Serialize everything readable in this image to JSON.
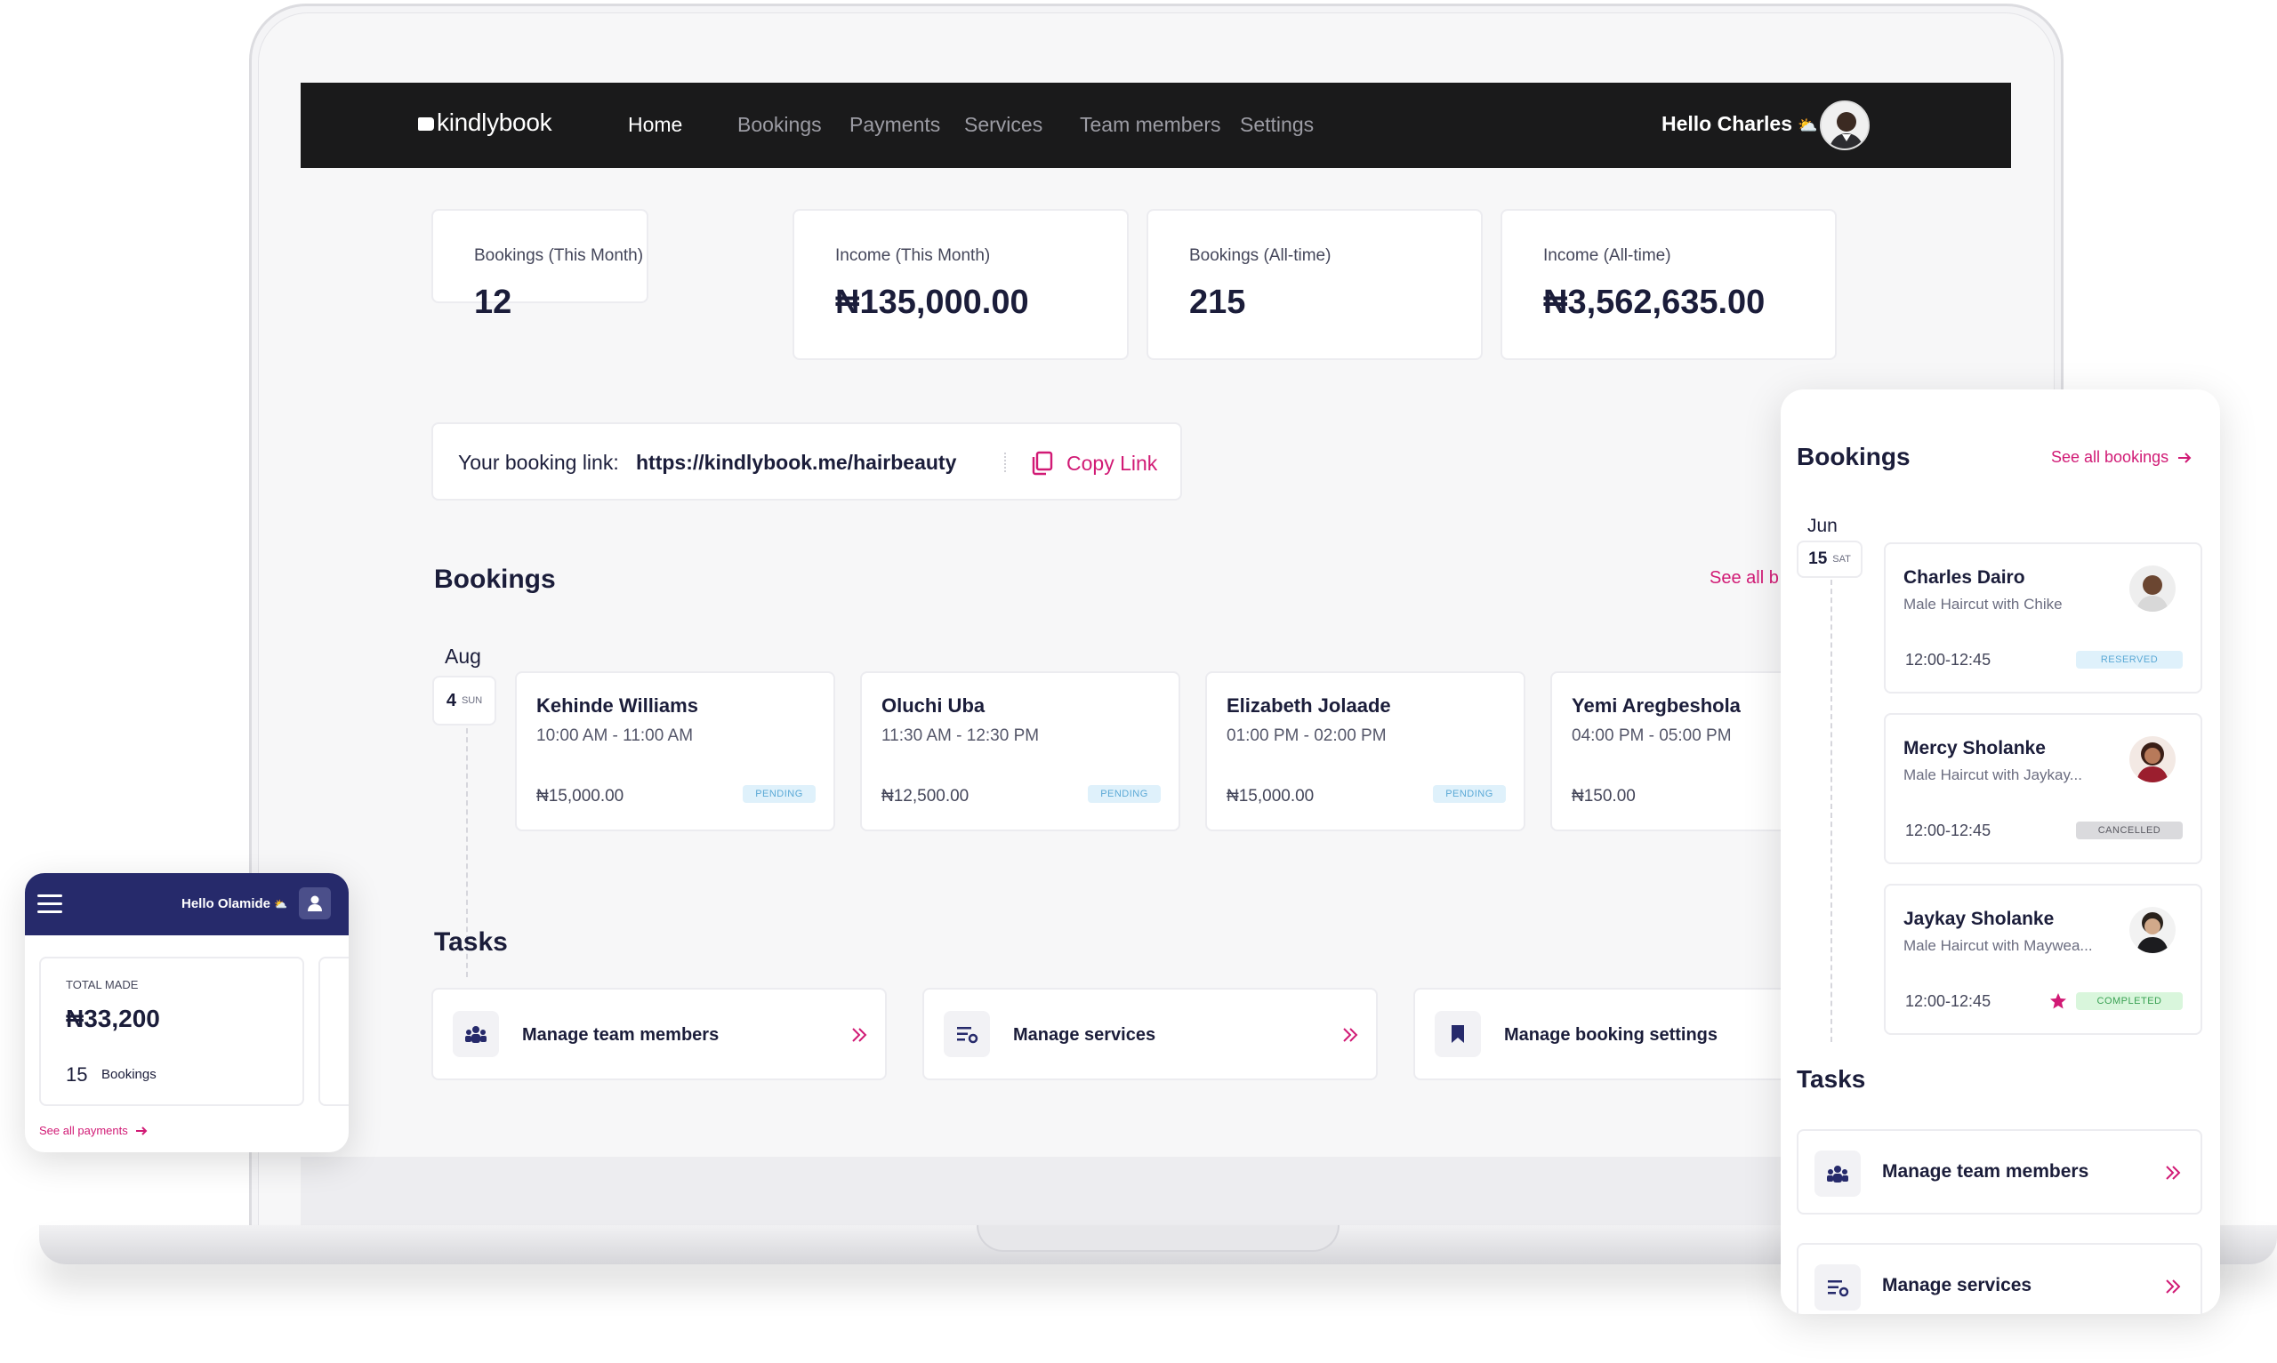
{
  "nav": {
    "logo": "kindlybook",
    "links": [
      "Home",
      "Bookings",
      "Payments",
      "Services",
      "Team members",
      "Settings"
    ],
    "greeting": "Hello Charles",
    "greeting_emoji": "⛅"
  },
  "stats": [
    {
      "label": "Bookings (This Month)",
      "value": "12"
    },
    {
      "label": "Income (This Month)",
      "value": "₦135,000.00"
    },
    {
      "label": "Bookings (All-time)",
      "value": "215"
    },
    {
      "label": "Income (All-time)",
      "value": "₦3,562,635.00"
    }
  ],
  "booking_link": {
    "label": "Your booking link:",
    "url": "https://kindlybook.me/hairbeauty",
    "copy_label": "Copy Link"
  },
  "bookings": {
    "title": "Bookings",
    "see_all": "See all b",
    "month": "Aug",
    "day": "4",
    "weekday": "SUN",
    "items": [
      {
        "name": "Kehinde Williams",
        "time": "10:00 AM - 11:00 AM",
        "price": "₦15,000.00",
        "status": "PENDING"
      },
      {
        "name": "Oluchi Uba",
        "time": "11:30 AM - 12:30 PM",
        "price": "₦12,500.00",
        "status": "PENDING"
      },
      {
        "name": "Elizabeth Jolaade",
        "time": "01:00 PM - 02:00 PM",
        "price": "₦15,000.00",
        "status": "PENDING"
      },
      {
        "name": "Yemi Aregbeshola",
        "time": "04:00 PM - 05:00 PM",
        "price": "₦150.00",
        "status": ""
      }
    ]
  },
  "tasks": {
    "title": "Tasks",
    "items": [
      {
        "label": "Manage team members",
        "icon": "team-icon"
      },
      {
        "label": "Manage services",
        "icon": "services-icon"
      },
      {
        "label": "Manage booking settings",
        "icon": "bookmark-icon"
      }
    ]
  },
  "mobile_left": {
    "greeting": "Hello Olamide",
    "greeting_emoji": "⛅",
    "total_label": "TOTAL MADE",
    "total_value": "₦33,200",
    "bookings_count": "15",
    "bookings_label": "Bookings",
    "see_all": "See all payments"
  },
  "mobile_right": {
    "title": "Bookings",
    "see_all": "See all bookings",
    "month": "Jun",
    "day": "15",
    "weekday": "SAT",
    "items": [
      {
        "name": "Charles Dairo",
        "service": "Male Haircut with Chike",
        "time": "12:00-12:45",
        "status": "RESERVED"
      },
      {
        "name": "Mercy Sholanke",
        "service": "Male Haircut with Jaykay...",
        "time": "12:00-12:45",
        "status": "CANCELLED"
      },
      {
        "name": "Jaykay Sholanke",
        "service": "Male Haircut with Maywea...",
        "time": "12:00-12:45",
        "status": "COMPLETED"
      }
    ],
    "tasks_title": "Tasks",
    "tasks": [
      {
        "label": "Manage team members",
        "icon": "team-icon"
      },
      {
        "label": "Manage services",
        "icon": "services-icon"
      }
    ]
  },
  "colors": {
    "accent": "#d11a75",
    "nav_bg": "#1a1a1b",
    "mobile_header": "#262a6b",
    "text": "#1b1d3a"
  }
}
